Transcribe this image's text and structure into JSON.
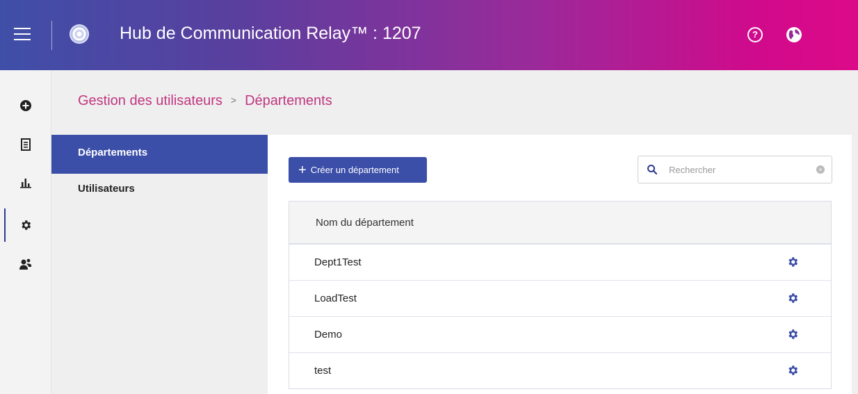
{
  "header": {
    "title": "Hub de Communication Relay™ : 1207",
    "icons": [
      "menu-icon",
      "relay-logo",
      "help-icon",
      "globe-icon"
    ]
  },
  "rail": {
    "items": [
      "add-icon",
      "document-icon",
      "chart-icon",
      "gear-icon",
      "users-icon"
    ],
    "active": "gear-icon"
  },
  "breadcrumb": {
    "parent": "Gestion des utilisateurs",
    "separator": ">",
    "current": "Départements"
  },
  "subnav": {
    "items": [
      {
        "label": "Départements",
        "active": true
      },
      {
        "label": "Utilisateurs",
        "active": false
      }
    ]
  },
  "toolbar": {
    "create_label": "Créer un département",
    "search_placeholder": "Rechercher"
  },
  "table": {
    "header": "Nom du département",
    "rows": [
      {
        "name": "Dept1Test"
      },
      {
        "name": "LoadTest"
      },
      {
        "name": "Demo"
      },
      {
        "name": "test"
      }
    ]
  },
  "colors": {
    "header_start": "#3f4fa8",
    "header_end": "#dc0a88",
    "accent": "#3b4ea8",
    "breadcrumb": "#c0367f"
  }
}
